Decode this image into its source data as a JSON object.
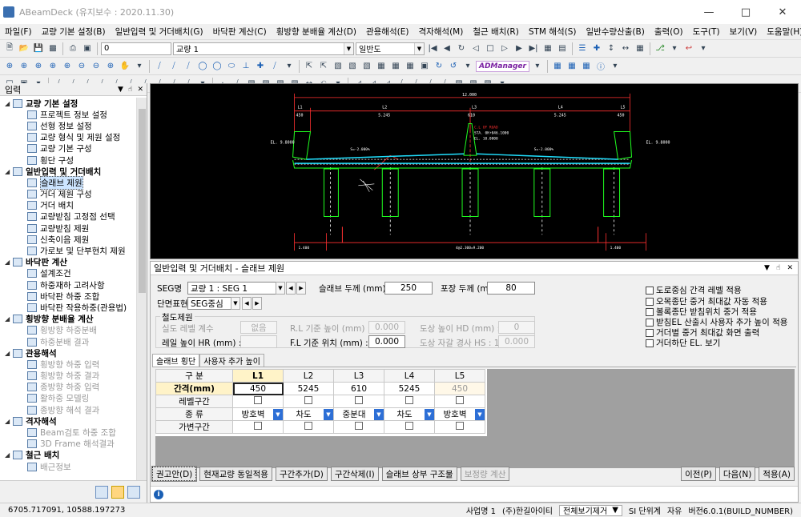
{
  "app": {
    "title": "ABeamDeck (유지보수 : 2020.11.30)"
  },
  "menu": [
    "파일(F)",
    "교량 기본 설정(B)",
    "일반입력 및 거더배치(G)",
    "바닥판 계산(C)",
    "횡방향 분배율 계산(D)",
    "관용해석(E)",
    "격자해석(M)",
    "철근 배치(R)",
    "STM 해석(S)",
    "일반수량산출(B)",
    "출력(O)",
    "도구(T)",
    "보기(V)",
    "도움말(H)"
  ],
  "toolbar": {
    "num_value": "0",
    "bridge_combo": "교량 1",
    "view_combo": "일반도",
    "admanager": "ADManager"
  },
  "left_panel": {
    "title": "입력",
    "tree": [
      {
        "type": "grp",
        "label": "교량 기본 설정"
      },
      {
        "type": "item",
        "label": "프로젝트 정보 설정"
      },
      {
        "type": "item",
        "label": "선형 정보 설정"
      },
      {
        "type": "item",
        "label": "교량 형식 및 제원 설정"
      },
      {
        "type": "item",
        "label": "교량 기본 구성"
      },
      {
        "type": "item",
        "label": "횡단 구성"
      },
      {
        "type": "grp",
        "label": "일반입력 및 거더배치"
      },
      {
        "type": "item",
        "label": "슬래브 제원",
        "selected": true
      },
      {
        "type": "item",
        "label": "거더 제원 구성"
      },
      {
        "type": "item",
        "label": "거더 배치"
      },
      {
        "type": "item",
        "label": "교량받침 고정점 선택"
      },
      {
        "type": "item",
        "label": "교량받침 제원"
      },
      {
        "type": "item",
        "label": "신축이음 제원"
      },
      {
        "type": "item",
        "label": "가로보 및 단부현치 제원"
      },
      {
        "type": "grp",
        "label": "바닥판 계산"
      },
      {
        "type": "item",
        "label": "설계조건"
      },
      {
        "type": "item",
        "label": "하중재하 고려사항"
      },
      {
        "type": "item",
        "label": "바닥판 하중 조합"
      },
      {
        "type": "item",
        "label": "바닥판 작용하중(관용법)"
      },
      {
        "type": "grp",
        "label": "횡방향 분배율 계산"
      },
      {
        "type": "item",
        "label": "횡방향 하중분배",
        "disabled": true
      },
      {
        "type": "item",
        "label": "하중분배 결과",
        "disabled": true
      },
      {
        "type": "grp",
        "label": "관용해석"
      },
      {
        "type": "item",
        "label": "횡방향 하중 입력",
        "disabled": true
      },
      {
        "type": "item",
        "label": "횡방향 하중 결과",
        "disabled": true
      },
      {
        "type": "item",
        "label": "종방향 하중 입력",
        "disabled": true
      },
      {
        "type": "item",
        "label": "활하중 모델링",
        "disabled": true
      },
      {
        "type": "item",
        "label": "종방향 해석 결과",
        "disabled": true
      },
      {
        "type": "grp",
        "label": "격자해석"
      },
      {
        "type": "item",
        "label": "Beam검토 하중 조합",
        "disabled": true
      },
      {
        "type": "item",
        "label": "3D Frame 해석결과",
        "disabled": true
      },
      {
        "type": "grp",
        "label": "철근 배치"
      },
      {
        "type": "item",
        "label": "배근정보",
        "disabled": true
      }
    ]
  },
  "cad": {
    "total_width": "12.000",
    "spans": [
      "L1",
      "L2",
      "L3",
      "L4",
      "L5"
    ],
    "span_values": [
      "450",
      "5.245",
      "610",
      "5.245",
      "450"
    ],
    "el_left": "EL. 9.8000",
    "el_right": "EL. 9.8000",
    "slope_left": "S=-2.000%",
    "slope_right": "S=-2.000%",
    "center_label1": "C.L OF ROAD",
    "center_label2": "STA. 0K+046.1000",
    "center_label3": "EL. 10.0000",
    "bottom_left": "1.400",
    "bottom_mid": "4@2.300=9.200",
    "bottom_right": "1.400"
  },
  "panel": {
    "title": "일반입력 및 거더배치 - 슬래브 제원",
    "seg_label": "SEG명",
    "seg_value": "교량 1 : SEG 1",
    "slab_thk_label": "슬래브 두께 (mm)",
    "slab_thk_value": "250",
    "pave_thk_label": "포장 두께 (mm)",
    "pave_thk_value": "80",
    "section_label": "단면표현",
    "section_value": "SEG중심",
    "rail_group": "철도제원",
    "rail_level_label": "실도 레벨 계수",
    "rail_level_value": "없음",
    "rail_height_label": "레일 높이 HR (mm) :",
    "rl_label": "R.L 기준 높이 (mm) :",
    "rl_value": "0.000",
    "fl_label": "F.L 기준 위치 (mm) :",
    "fl_value": "0.000",
    "hd_label": "도상 높이 HD (mm) :",
    "hd_value": "0",
    "hs_label": "도상 자갈 경사 HS : 1 :",
    "hs_value": "0.000",
    "checks": [
      "도로중심 간격 레벨 적용",
      "오목종단 중거 최대값 자동 적용",
      "볼록종단 받침위치 중거 적용",
      "받침EL 산출시 사용자 추가 높이 적용",
      "거더별 중거 최대값 화면 출력",
      "거더하단 EL. 보기"
    ],
    "tabs": [
      "슬래브 횡단",
      "사용자 추가 높이"
    ],
    "grid": {
      "corner": "구 분",
      "cols": [
        "L1",
        "L2",
        "L3",
        "L4",
        "L5"
      ],
      "rows": [
        {
          "label": "간격(mm)",
          "values": [
            "450",
            "5245",
            "610",
            "5245",
            "450"
          ]
        },
        {
          "label": "레벨구간"
        },
        {
          "label": "종 류",
          "values": [
            "방호벽",
            "차도",
            "중분대",
            "차도",
            "방호벽"
          ]
        },
        {
          "label": "가변구간"
        }
      ]
    },
    "buttons": [
      "권고안(D)",
      "현재교량 동일적용",
      "구간추가(D)",
      "구간삭제(I)",
      "슬래브 상부 구조물",
      "보정량 계산"
    ],
    "right_buttons": [
      "이전(P)",
      "다음(N)",
      "적용(A)"
    ]
  },
  "status": {
    "coord": "6705.717091,   10588.197273",
    "biz": "사업명 1",
    "company": "(주)한길아이티",
    "view": "전체보기제거",
    "unit": "SI 단위계",
    "mode": "자유",
    "version": "버전6.0.1(BUILD_NUMBER)"
  }
}
